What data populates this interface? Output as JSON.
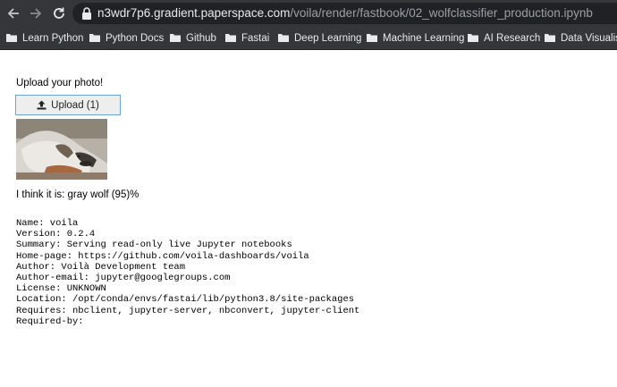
{
  "browser": {
    "url_host": "n3wdr7p6.gradient.paperspace.com",
    "url_path": "/voila/render/fastbook/02_wolfclassifier_production.ipynb",
    "icons": [
      "back-arrow-icon",
      "forward-arrow-icon",
      "reload-icon",
      "lock-icon",
      "folder-icon"
    ]
  },
  "bookmarks": [
    {
      "label": "Learn Python"
    },
    {
      "label": "Python Docs"
    },
    {
      "label": "Github"
    },
    {
      "label": "Fastai"
    },
    {
      "label": "Deep Learning"
    },
    {
      "label": "Machine Learning"
    },
    {
      "label": "AI Research"
    },
    {
      "label": "Data Visualisa"
    }
  ],
  "app": {
    "upload_prompt": "Upload your photo!",
    "upload_button_label": "Upload (1)",
    "prediction": "I think it is: gray wolf (95)%",
    "pip_info": [
      "Name: voila",
      "Version: 0.2.4",
      "Summary: Serving read-only live Jupyter notebooks",
      "Home-page: https://github.com/voila-dashboards/voila",
      "Author: Voilà Development team",
      "Author-email: jupyter@googlegroups.com",
      "License: UNKNOWN",
      "Location: /opt/conda/envs/fastai/lib/python3.8/site-packages",
      "Requires: nbclient, jupyter-server, nbconvert, jupyter-client",
      "Required-by:"
    ]
  },
  "colors": {
    "browser_chrome": "#35363a",
    "omnibox": "#202124",
    "button_border": "#6aa7d6",
    "button_bg": "#eeeeee"
  }
}
